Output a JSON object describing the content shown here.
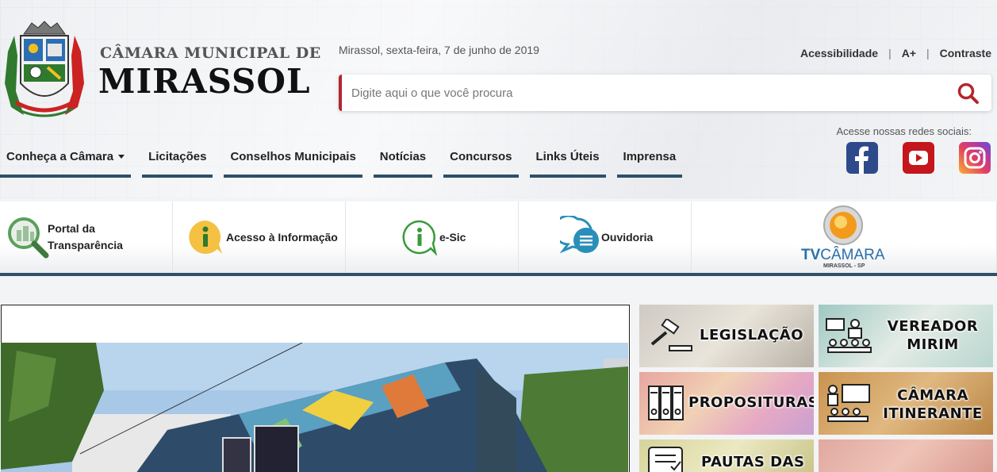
{
  "brand": {
    "line1": "CÂMARA MUNICIPAL DE",
    "line2": "MIRASSOL",
    "logo_icon": "coat-of-arms-icon"
  },
  "date": "Mirassol, sexta-feira, 7 de junho de 2019",
  "top_links": [
    "Acessibilidade",
    "A+",
    "Contraste"
  ],
  "search": {
    "placeholder": "Digite aqui o que você procura",
    "icon": "search-icon"
  },
  "social": {
    "label": "Acesse nossas redes sociais:",
    "items": [
      "facebook-icon",
      "youtube-icon",
      "instagram-icon"
    ]
  },
  "nav": [
    {
      "label": "Conheça a Câmara",
      "dropdown": true
    },
    {
      "label": "Licitações"
    },
    {
      "label": "Conselhos Municipais"
    },
    {
      "label": "Notícias"
    },
    {
      "label": "Concursos"
    },
    {
      "label": "Links Úteis"
    },
    {
      "label": "Imprensa"
    }
  ],
  "quick": {
    "transparencia": [
      "Portal da",
      "Transparência"
    ],
    "acesso": "Acesso à Informação",
    "esic": "e-Sic",
    "ouvidoria": "Ouvidoria",
    "tv": {
      "tv": "TV",
      "camara": "CÂMARA",
      "sub": "MIRASSOL - SP"
    }
  },
  "tiles": {
    "legislacao": "LEGISLAÇÃO",
    "vereador": [
      "VEREADOR",
      "MIRIM"
    ],
    "proposituras": "PROPOSITURAS",
    "itinerante": [
      "CÂMARA",
      "ITINERANTE"
    ],
    "pautas": "PAUTAS DAS"
  },
  "colors": {
    "accent": "#2e5068",
    "search_border": "#b3262d",
    "facebook": "#2e4a8a",
    "youtube": "#c4161c"
  }
}
